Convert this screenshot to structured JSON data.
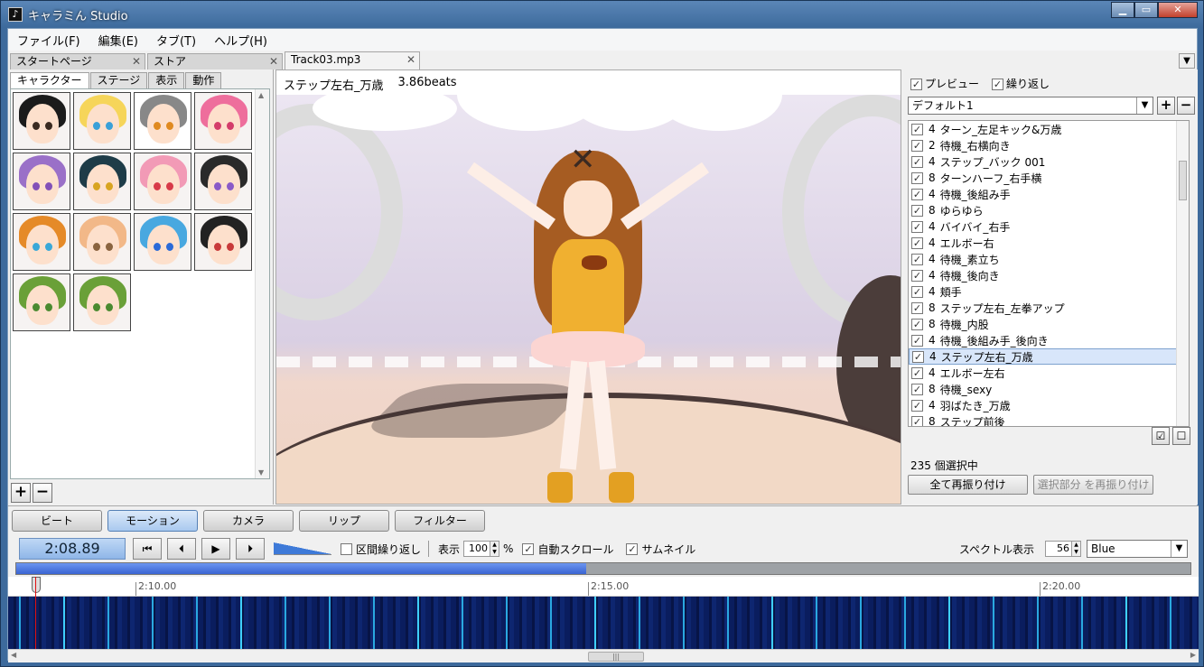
{
  "window": {
    "title": "キャラミん Studio",
    "min_label": "▁",
    "max_label": "▭",
    "close_label": "✕"
  },
  "menu": [
    "ファイル(F)",
    "編集(E)",
    "タブ(T)",
    "ヘルプ(H)"
  ],
  "doc_tabs": [
    {
      "label": "スタートページ",
      "close": "✕"
    },
    {
      "label": "ストア",
      "close": "✕"
    },
    {
      "label": "Track03.mp3",
      "close": "✕"
    }
  ],
  "left": {
    "subtabs": [
      "キャラクター",
      "ステージ",
      "表示",
      "動作"
    ],
    "characters": [
      {
        "hair": "#1b1b1b",
        "eye": "#3a2a20"
      },
      {
        "hair": "#f6d55a",
        "eye": "#3aa0d8"
      },
      {
        "hair": "#888888",
        "eye": "#e08a20"
      },
      {
        "hair": "#ee6e9c",
        "eye": "#d43d6a"
      },
      {
        "hair": "#9a70c8",
        "eye": "#8250b8"
      },
      {
        "hair": "#1e3c48",
        "eye": "#d8a420"
      },
      {
        "hair": "#f29ab6",
        "eye": "#d83a48"
      },
      {
        "hair": "#2a2a2a",
        "eye": "#8a5ac8"
      },
      {
        "hair": "#e58a28",
        "eye": "#3aa8d8"
      },
      {
        "hair": "#f2b888",
        "eye": "#8a6440"
      },
      {
        "hair": "#48a8e0",
        "eye": "#2a6ad8"
      },
      {
        "hair": "#222222",
        "eye": "#c83a3a"
      },
      {
        "hair": "#6aa038",
        "eye": "#4a8a30"
      },
      {
        "hair": "#6aa038",
        "eye": "#4a8a30"
      }
    ],
    "add": "+",
    "remove": "−"
  },
  "viewport": {
    "motion_name": "ステップ左右_万歳",
    "beats": "3.86beats"
  },
  "right": {
    "preview_label": "プレビュー",
    "repeat_label": "繰り返し",
    "preset": "デフォルト1",
    "add": "+",
    "remove": "−",
    "motions": [
      {
        "count": "4",
        "name": "ターン_左足キック&万歳"
      },
      {
        "count": "2",
        "name": "待機_右横向き"
      },
      {
        "count": "4",
        "name": "ステップ_バック 001"
      },
      {
        "count": "8",
        "name": "ターンハーフ_右手横"
      },
      {
        "count": "4",
        "name": "待機_後組み手"
      },
      {
        "count": "8",
        "name": "ゆらゆら"
      },
      {
        "count": "4",
        "name": "バイバイ_右手"
      },
      {
        "count": "4",
        "name": "エルボー右"
      },
      {
        "count": "4",
        "name": "待機_素立ち"
      },
      {
        "count": "4",
        "name": "待機_後向き"
      },
      {
        "count": "4",
        "name": "頬手"
      },
      {
        "count": "8",
        "name": "ステップ左右_左拳アップ"
      },
      {
        "count": "8",
        "name": "待機_内股"
      },
      {
        "count": "4",
        "name": "待機_後組み手_後向き"
      },
      {
        "count": "4",
        "name": "ステップ左右_万歳"
      },
      {
        "count": "4",
        "name": "エルボー左右"
      },
      {
        "count": "8",
        "name": "待機_sexy"
      },
      {
        "count": "4",
        "name": "羽ばたき_万歳"
      },
      {
        "count": "8",
        "name": "ステップ前後"
      }
    ],
    "selected_index": 14,
    "selected_count": "235 個選択中",
    "reassign_all": "全て再振り付け",
    "reassign_selected": "選択部分 を再振り付け"
  },
  "bottom": {
    "mode_tabs": [
      "ビート",
      "モーション",
      "カメラ",
      "リップ",
      "フィルター"
    ],
    "active_mode": 1,
    "time": "2:08.89",
    "loop_label": "区間繰り返し",
    "display_label": "表示",
    "zoom_value": "100",
    "zoom_unit": "%",
    "autoscroll_label": "自動スクロール",
    "thumbnail_label": "サムネイル",
    "spectrum_label": "スペクトル表示",
    "spectrum_value": "56",
    "color": "Blue",
    "progress": 0.485,
    "ruler": [
      "2:10.00",
      "2:15.00",
      "2:20.00"
    ]
  }
}
